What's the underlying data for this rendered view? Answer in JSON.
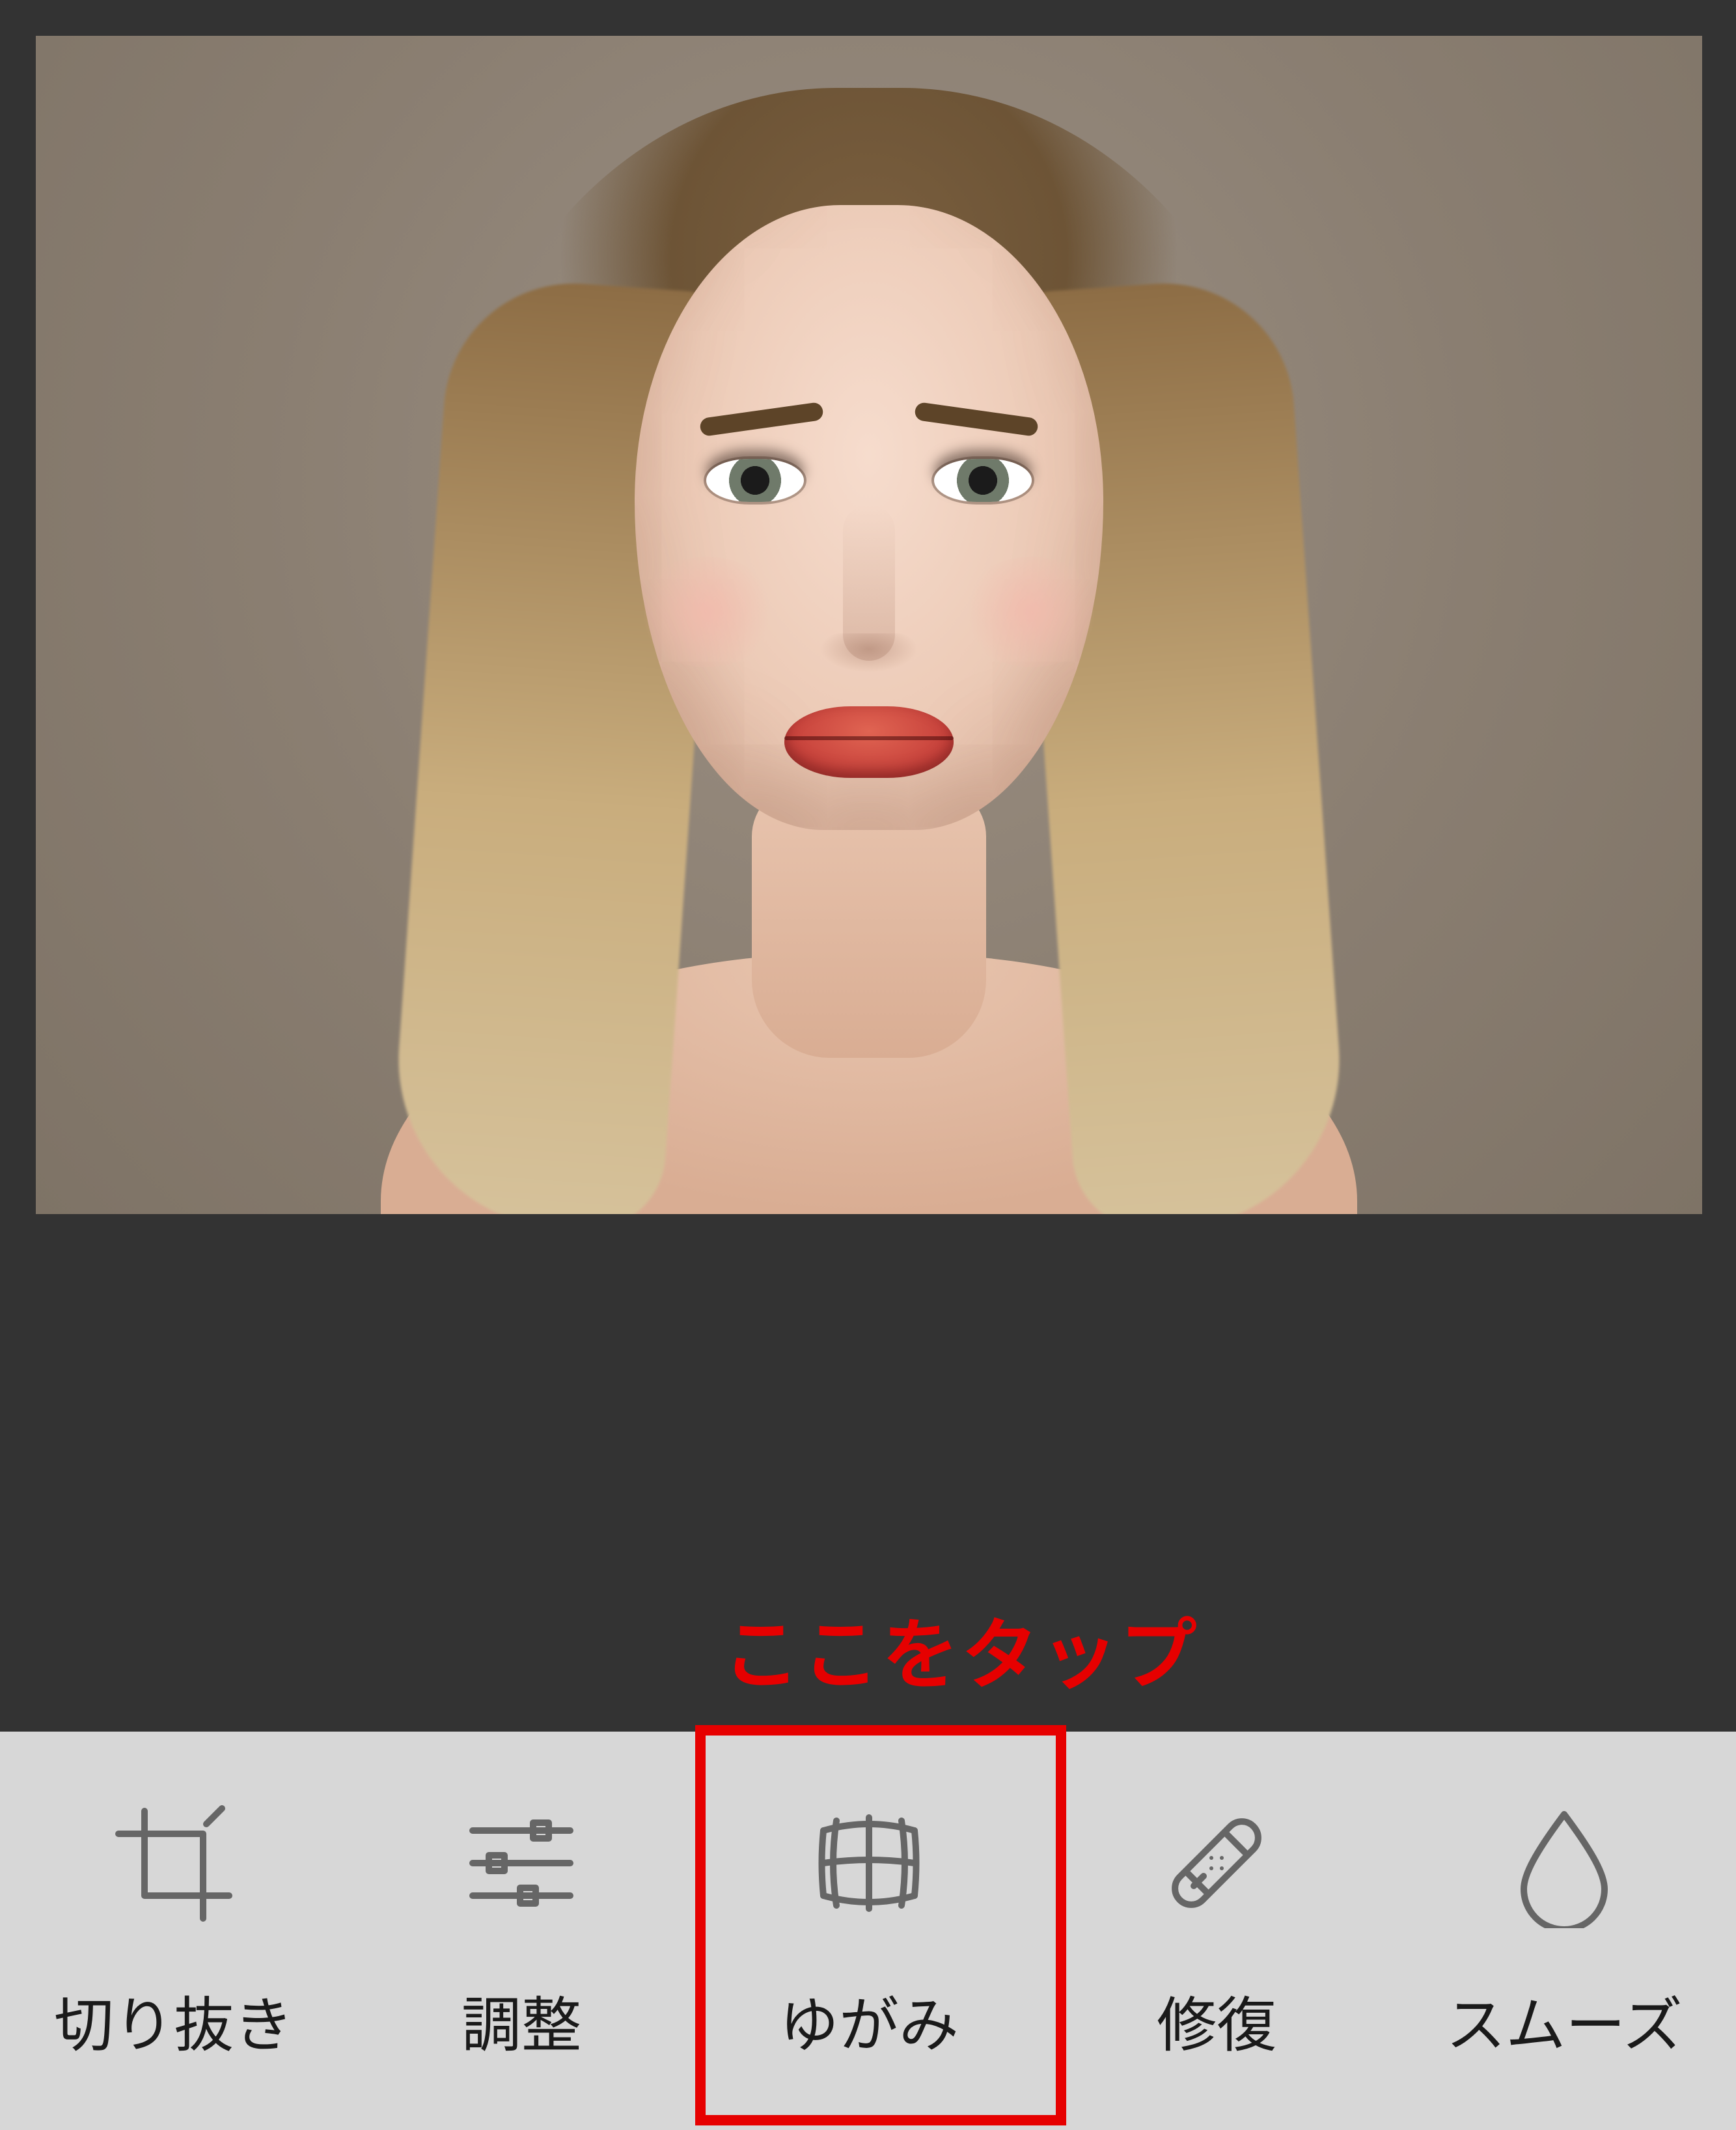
{
  "annotation": {
    "text": "ここをタップ"
  },
  "toolbar": {
    "items": [
      {
        "id": "crop",
        "label": "切り抜き"
      },
      {
        "id": "adjust",
        "label": "調整"
      },
      {
        "id": "distort",
        "label": "ゆがみ"
      },
      {
        "id": "heal",
        "label": "修復"
      },
      {
        "id": "smooth",
        "label": "スムーズ"
      }
    ]
  }
}
